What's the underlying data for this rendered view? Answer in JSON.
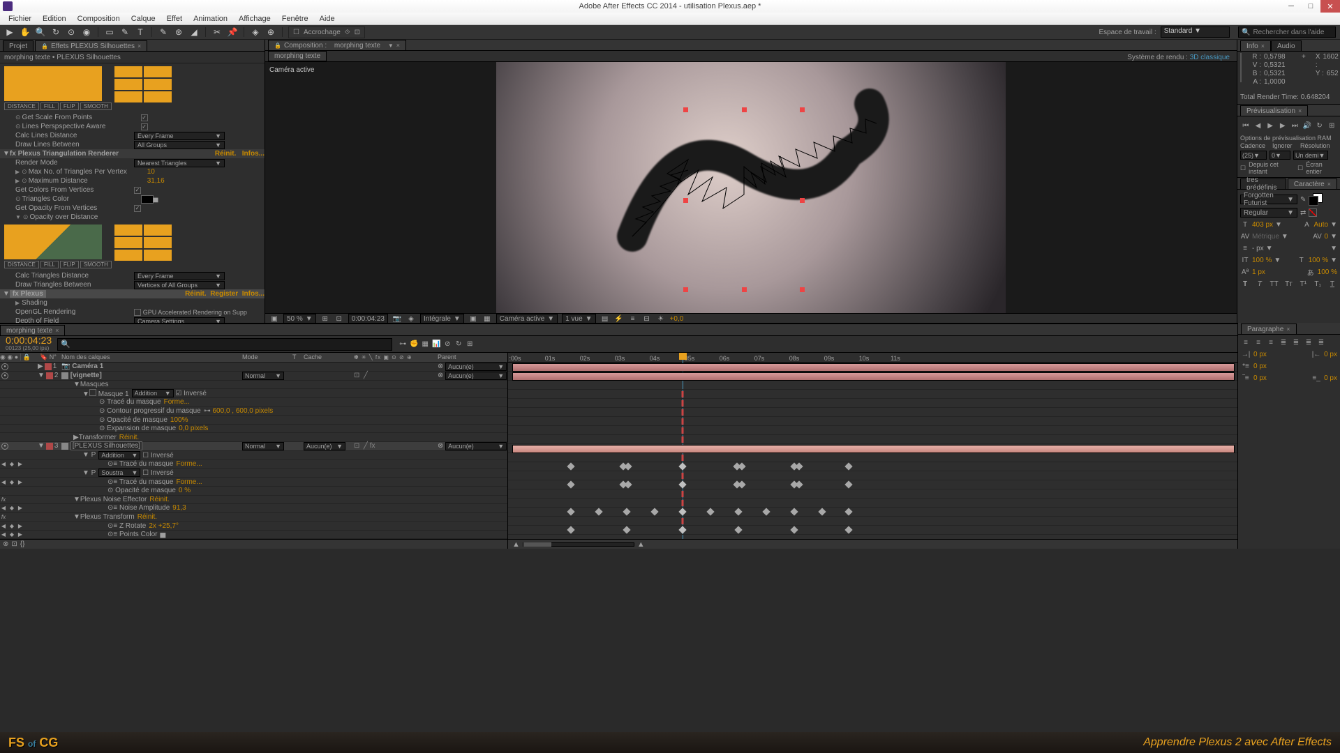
{
  "app": {
    "title": "Adobe After Effects CC 2014 - utilisation Plexus.aep *",
    "menus": [
      "Fichier",
      "Edition",
      "Composition",
      "Calque",
      "Effet",
      "Animation",
      "Affichage",
      "Fenêtre",
      "Aide"
    ]
  },
  "toolbar": {
    "snap": "Accrochage",
    "workspace_label": "Espace de travail :",
    "workspace": "Standard",
    "search_placeholder": "Rechercher dans l'aide"
  },
  "project_tabs": [
    "Projet",
    "Effets PLEXUS Silhouettes"
  ],
  "breadcrumb": "morphing texte • PLEXUS Silhouettes",
  "fx": {
    "graph1_labels": [
      "DISTANCE",
      "FILL",
      "FLIP",
      "SMOOTH"
    ],
    "rows1": [
      {
        "name": "Get Scale From Points",
        "chk": true,
        "sw": true
      },
      {
        "name": "Lines Perspspective Aware",
        "chk": true,
        "sw": true
      },
      {
        "name": "Calc Lines Distance",
        "sel": "Every Frame"
      },
      {
        "name": "Draw Lines Between",
        "sel": "All Groups"
      }
    ],
    "section_head": "fx  Plexus Triangulation Renderer",
    "section_links": [
      "Réinit.",
      "Infos..."
    ],
    "rows2": [
      {
        "name": "Render Mode",
        "sel": "Nearest Triangles"
      },
      {
        "name": "Max No. of Triangles Per Vertex",
        "val": "10",
        "sw": true
      },
      {
        "name": "Maximum Distance",
        "val": "31,16",
        "sw": true
      },
      {
        "name": "Get Colors From Vertices",
        "chk": true
      },
      {
        "name": "Triangles Color",
        "swatch": true,
        "sw": true
      },
      {
        "name": "Get Opacity From Vertices",
        "chk": true
      },
      {
        "name": "Opacity over Distance",
        "tri": true,
        "sw": true
      }
    ],
    "rows3": [
      {
        "name": "Calc Triangles Distance",
        "sel": "Every Frame"
      },
      {
        "name": "Draw Triangles Between",
        "sel": "Vertices of All Groups"
      }
    ],
    "plexus_head": "fx  Plexus",
    "plexus_links": [
      "Réinit.",
      "Register",
      "Infos..."
    ],
    "rows4": [
      {
        "name": "Shading"
      },
      {
        "name": "OpenGL Rendering",
        "chk": false,
        "chk_label": "GPU Accelerated Rendering on Supp"
      },
      {
        "name": "Depth of Field",
        "sel": "Camera Settings"
      }
    ]
  },
  "comp": {
    "tab_prefix": "Composition :",
    "tab_name": "morphing texte",
    "mini_tab": "morphing texte",
    "cam_label": "Caméra active",
    "render_sys_label": "Système de rendu :",
    "render_sys": "3D classique",
    "footer": {
      "zoom": "50 %",
      "time": "0:00:04:23",
      "resolution": "Intégrale",
      "view": "Caméra active",
      "views": "1 vue",
      "exposure": "+0,0"
    }
  },
  "info": {
    "title": "Info",
    "audio": "Audio",
    "R": "0,5798",
    "V": "0,5321",
    "B": "0,5321",
    "A": "1,0000",
    "X": "1602",
    "Y": "652",
    "render": "Total Render Time: 0.648204"
  },
  "preview": {
    "title": "Prévisualisation",
    "ram": "Options de prévisualisation RAM",
    "cadence": "Cadence",
    "ignorer": "Ignorer",
    "resol": "Résolution",
    "fps": "(25)",
    "skip": "0",
    "res": "Un demi",
    "chk1": "Depuis cet instant",
    "chk2": "Écran entier"
  },
  "char": {
    "presets": "tres prédéfinis",
    "title": "Caractère",
    "font": "Forgotten Futurist",
    "style": "Regular",
    "size": "403 px",
    "lead": "Auto",
    "kern": "Métrique",
    "track": "0",
    "vscale": "100 %",
    "hscale": "100 %",
    "baseline": "- px",
    "tsume": "-",
    "stroke": "1 px",
    "strokepct": "100 %",
    "styles": [
      "T",
      "T",
      "T'",
      "Tr",
      "T¹",
      "T₁",
      "T"
    ]
  },
  "timeline": {
    "tab": "morphing texte",
    "time": "0:00:04:23",
    "frames": "00123 (25,00 ips)",
    "cols": {
      "icons": "",
      "num": "N°",
      "name": "Nom des calques",
      "mode": "Mode",
      "t": "T",
      "cache": "Cache",
      "parent": "Parent"
    },
    "switch_header": "✽ ✳ ╲ fx ▣ ⊙ ⊘ ⊕",
    "none": "Aucun(e)",
    "mode_normal": "Normal",
    "mode_add": "Addition",
    "mode_sub": "Soustra",
    "inverse": "Inversé",
    "forme": "Forme...",
    "reinit": "Réinit.",
    "layers": [
      {
        "n": "1",
        "name": "Caméra 1",
        "color": "#b04848",
        "parent": "Aucun(e)"
      },
      {
        "n": "2",
        "name": "[vignette]",
        "color": "#b04848",
        "mode": "Normal",
        "parent": "Aucun(e)"
      }
    ],
    "masques": "Masques",
    "mask1": "Masque 1",
    "mask_props": [
      {
        "name": "Tracé du masque",
        "val": "Forme..."
      },
      {
        "name": "Contour progressif du masque",
        "val": "600,0 , 600,0 pixels",
        "link": true
      },
      {
        "name": "Opacité de masque",
        "val": "100%"
      },
      {
        "name": "Expansion de masque",
        "val": "0,0 pixels"
      }
    ],
    "transformer": "Transformer",
    "transformer_val": "Réinit.",
    "layer3": {
      "n": "3",
      "name": "[PLEXUS Silhouettes]",
      "color": "#b04848",
      "mode": "Normal",
      "cache": "Aucun(e)",
      "parent": "Aucun(e)"
    },
    "p_props": [
      {
        "name": "P",
        "maskmode": "Addition",
        "inv": false
      },
      {
        "name": "Tracé du masque",
        "val": "Forme...",
        "kf": true
      },
      {
        "name": "P",
        "maskmode": "Soustra",
        "inv": false
      },
      {
        "name": "Tracé du masque",
        "val": "Forme...",
        "kf": true
      },
      {
        "name": "Opacité de masque",
        "val": "0 %"
      }
    ],
    "effectors": [
      {
        "head": "Plexus Noise Effector",
        "val": "Réinit."
      },
      {
        "sub": "Noise Amplitude",
        "val": "91,3",
        "kf": true
      },
      {
        "head": "Plexus Transform",
        "val": "Réinit."
      },
      {
        "sub": "Z Rotate",
        "val": "2x +25,7°",
        "kf": true
      },
      {
        "sub": "Points Color",
        "swatch": true
      }
    ],
    "ruler": [
      ":00s",
      "01s",
      "02s",
      "03s",
      "04s",
      "05s",
      "06s",
      "07s",
      "08s",
      "09s",
      "10s",
      "11s"
    ]
  },
  "paragraph": {
    "title": "Paragraphe",
    "ind": "0 px"
  },
  "brand": {
    "logo": "FS",
    "of": "of",
    "cg": "CG",
    "tag": "Apprendre Plexus 2 avec After Effects"
  }
}
